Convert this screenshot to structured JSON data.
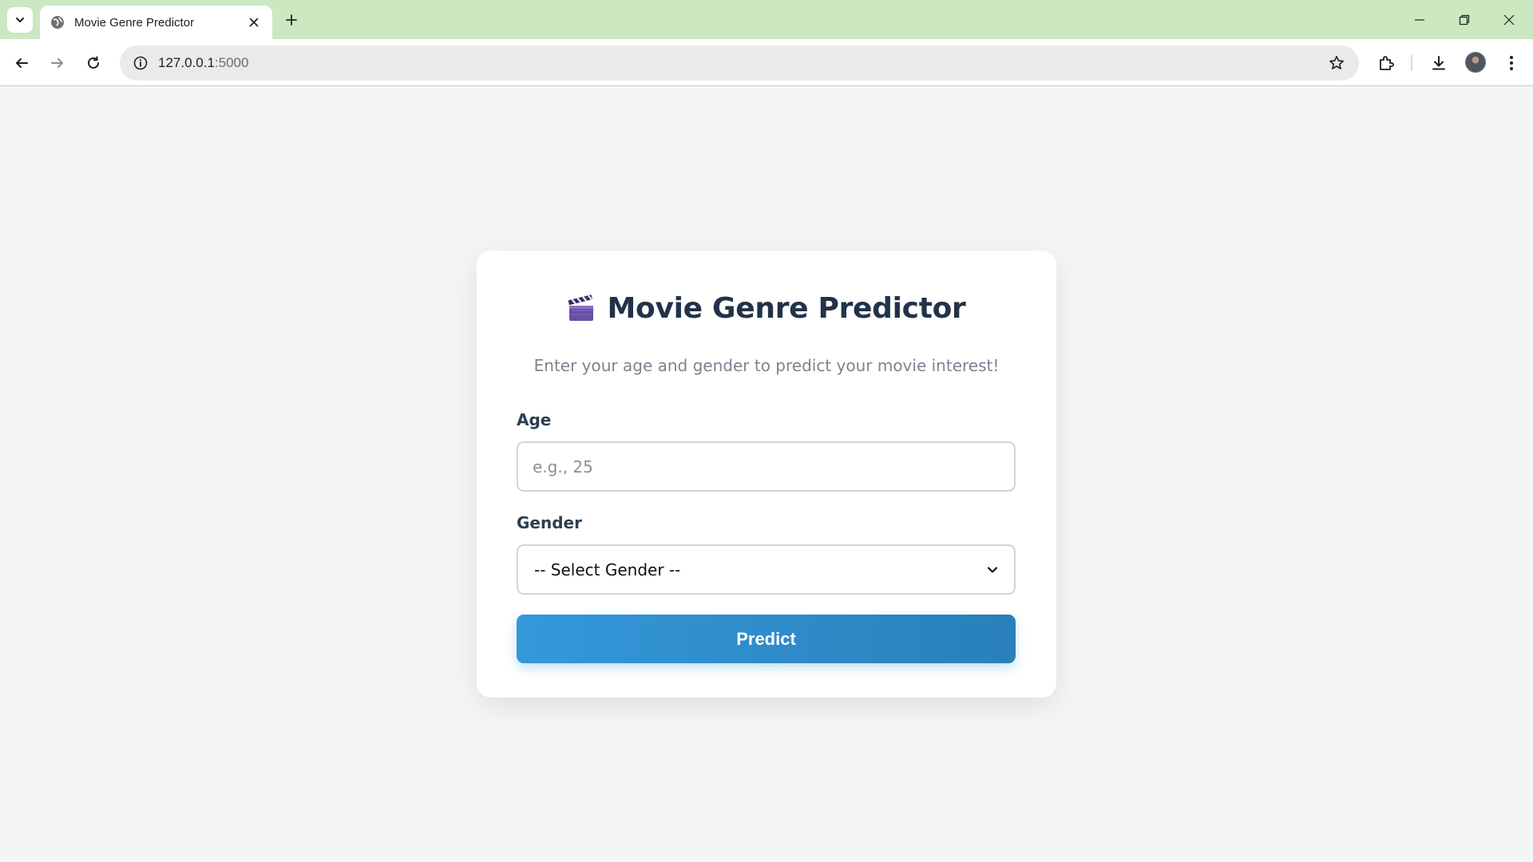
{
  "browser": {
    "tab_title": "Movie Genre Predictor",
    "url_host": "127.0.0.1",
    "url_port": ":5000",
    "icons": [
      "tab-search-icon",
      "globe-icon",
      "close-icon",
      "plus-icon",
      "minimize-icon",
      "restore-icon",
      "close-window-icon",
      "back-arrow-icon",
      "forward-arrow-icon",
      "reload-icon",
      "info-icon",
      "star-icon",
      "extensions-icon",
      "download-icon",
      "avatar",
      "more-vertical-icon"
    ]
  },
  "page": {
    "heading": "Movie Genre Predictor",
    "heading_icon": "clapperboard-icon",
    "subtitle": "Enter your age and gender to predict your movie interest!",
    "age_label": "Age",
    "age_placeholder": "e.g., 25",
    "gender_label": "Gender",
    "gender_selected": "-- Select Gender --",
    "predict_label": "Predict"
  },
  "colors": {
    "tabbar": "#cbe8c0",
    "page_bg": "#f4f6f5",
    "heading": "#22324a",
    "button_start": "#3498db",
    "button_end": "#2980b9"
  }
}
